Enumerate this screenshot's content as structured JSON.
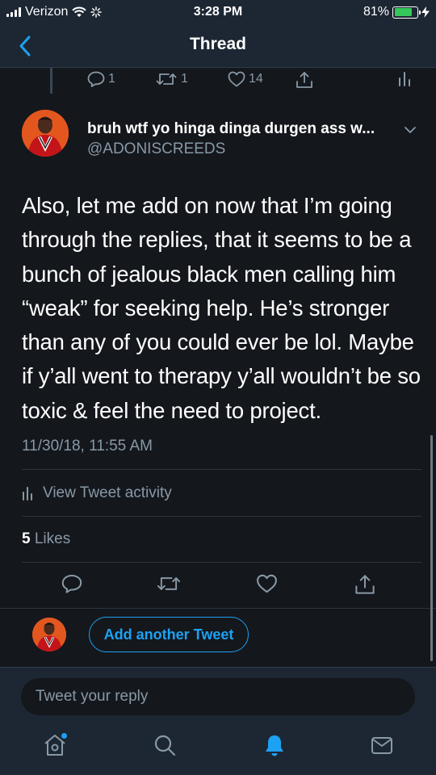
{
  "status_bar": {
    "carrier": "Verizon",
    "time": "3:28 PM",
    "battery": "81%",
    "battery_level": 0.81
  },
  "nav": {
    "title": "Thread",
    "back_icon": "chevron-left-icon"
  },
  "previous_tweet_actions": {
    "reply_count": "1",
    "retweet_count": "1",
    "like_count": "14"
  },
  "tweet": {
    "display_name": "bruh wtf yo hinga dinga durgen ass w...",
    "handle": "@ADONISCREEDS",
    "text": "Also, let me add on now that I’m going through the replies, that it seems to be a bunch of jealous black men calling him “weak” for seeking help. He’s stronger than any of you could ever be lol. Maybe if y’all went to therapy y’all wouldn’t be so toxic & feel the need to project.",
    "timestamp": "11/30/18, 11:55 AM",
    "activity_label": "View Tweet activity",
    "likes_count": "5",
    "likes_label": "Likes"
  },
  "compose": {
    "add_tweet_label": "Add another Tweet",
    "reply_placeholder": "Tweet your reply"
  },
  "colors": {
    "accent": "#1da1f2",
    "background": "#14171c",
    "surface": "#1c2733",
    "muted_text": "#8899a6",
    "battery": "#35c759"
  }
}
